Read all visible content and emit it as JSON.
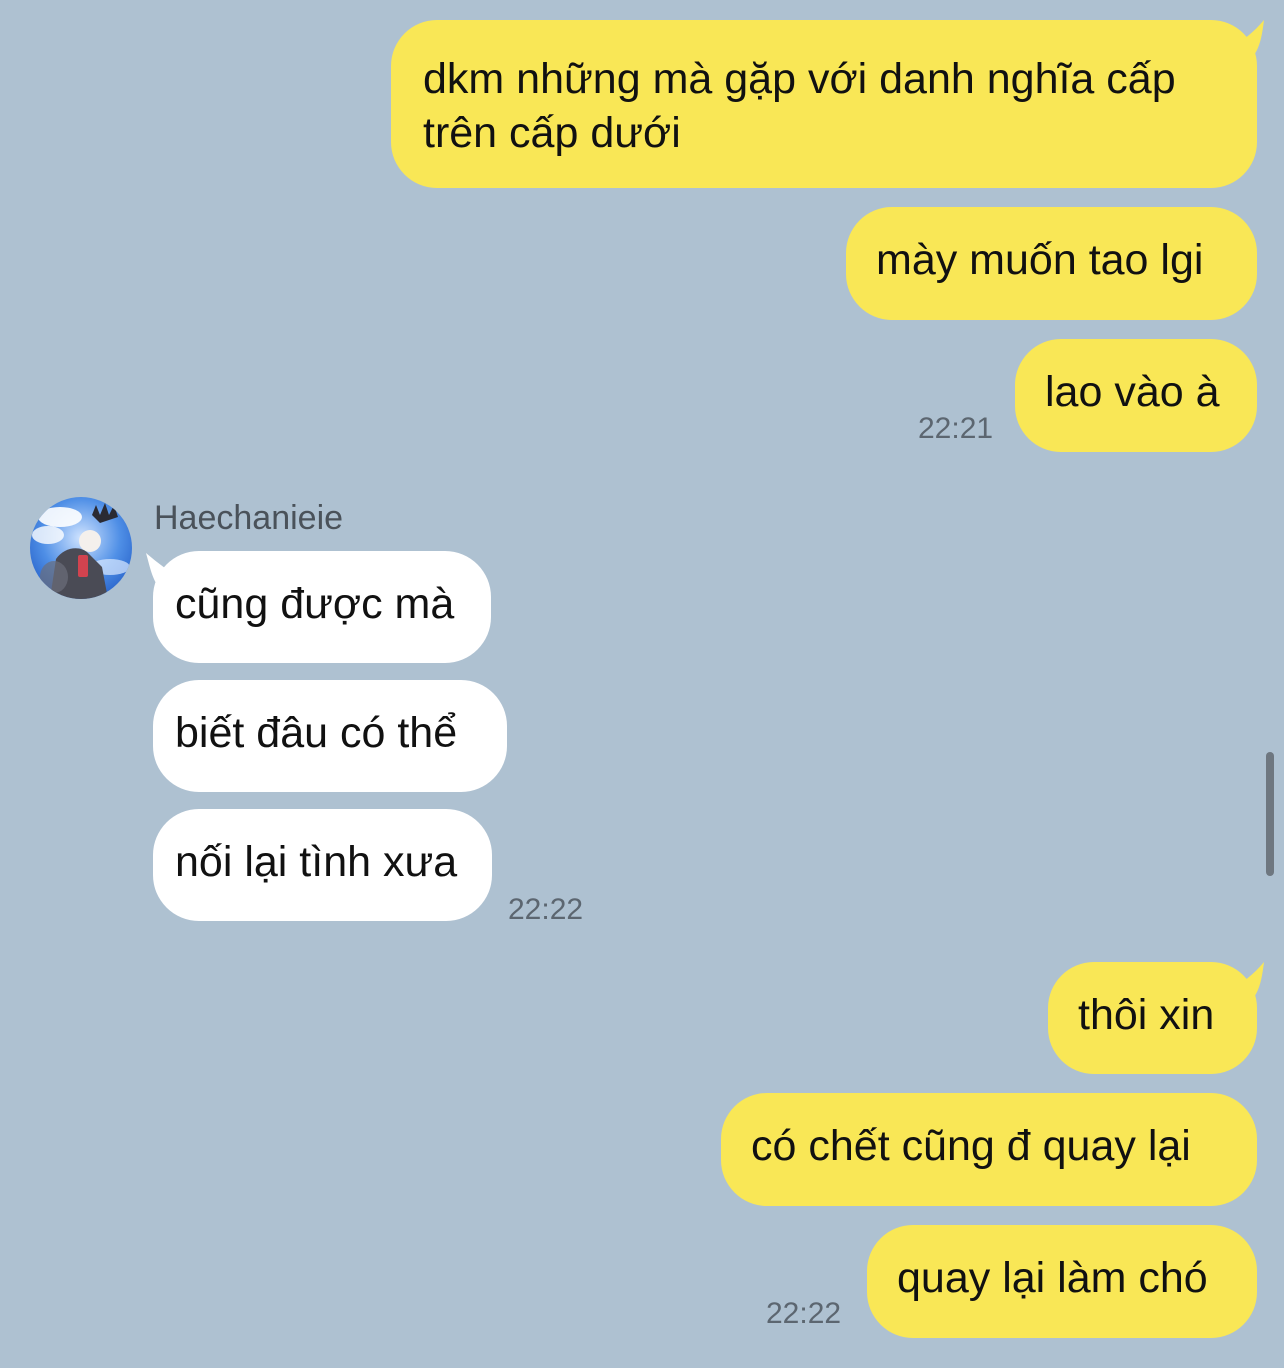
{
  "chat": {
    "contact": {
      "name": "Haechanieie",
      "avatar_icon": "contact-avatar-photo"
    },
    "colors": {
      "background": "#aec1d1",
      "outgoing_bubble": "#f9e756",
      "incoming_bubble": "#ffffff",
      "timestamp": "#5c6670"
    },
    "messages": [
      {
        "direction": "outgoing",
        "text": "dkm những mà gặp với danh nghĩa cấp trên cấp dưới"
      },
      {
        "direction": "outgoing",
        "text": "mày muốn tao lgi"
      },
      {
        "direction": "outgoing",
        "text": "lao vào à",
        "time": "22:21"
      },
      {
        "direction": "incoming",
        "sender": "Haechanieie",
        "text": "cũng được mà"
      },
      {
        "direction": "incoming",
        "text": "biết đâu có thể"
      },
      {
        "direction": "incoming",
        "text": "nối lại tình xưa",
        "time": "22:22"
      },
      {
        "direction": "outgoing",
        "text": "thôi xin"
      },
      {
        "direction": "outgoing",
        "text": "có chết cũng đ quay lại"
      },
      {
        "direction": "outgoing",
        "text": "quay lại làm chó",
        "time": "22:22"
      }
    ]
  }
}
